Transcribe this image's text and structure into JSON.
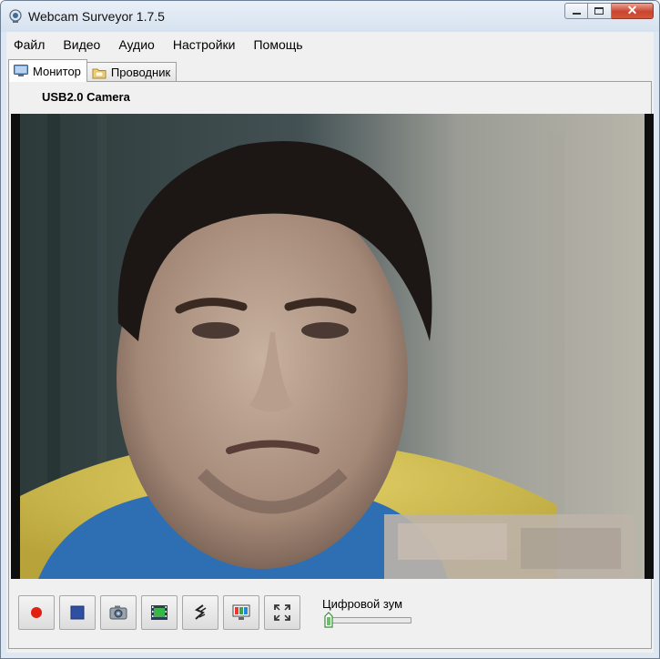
{
  "window": {
    "title": "Webcam Surveyor 1.7.5"
  },
  "menu": [
    "Файл",
    "Видео",
    "Аудио",
    "Настройки",
    "Помощь"
  ],
  "tabs": [
    {
      "label": "Монитор",
      "icon": "monitor-icon",
      "active": true
    },
    {
      "label": "Проводник",
      "icon": "folder-icon",
      "active": false
    }
  ],
  "camera": {
    "name": "USB2.0 Camera"
  },
  "toolbar": {
    "buttons": [
      {
        "name": "record-button",
        "icon": "record-icon"
      },
      {
        "name": "stop-button",
        "icon": "stop-icon"
      },
      {
        "name": "snapshot-button",
        "icon": "camera-icon"
      },
      {
        "name": "video-capture-button",
        "icon": "film-icon"
      },
      {
        "name": "motion-detector-button",
        "icon": "motion-icon"
      },
      {
        "name": "broadcast-button",
        "icon": "screen-icon"
      },
      {
        "name": "fullscreen-button",
        "icon": "fullscreen-icon"
      }
    ]
  },
  "zoom": {
    "label": "Цифровой зум",
    "value": 0
  },
  "colors": {
    "accent": "#cc3a2a",
    "record": "#e02010",
    "stop": "#2f4fa0"
  }
}
